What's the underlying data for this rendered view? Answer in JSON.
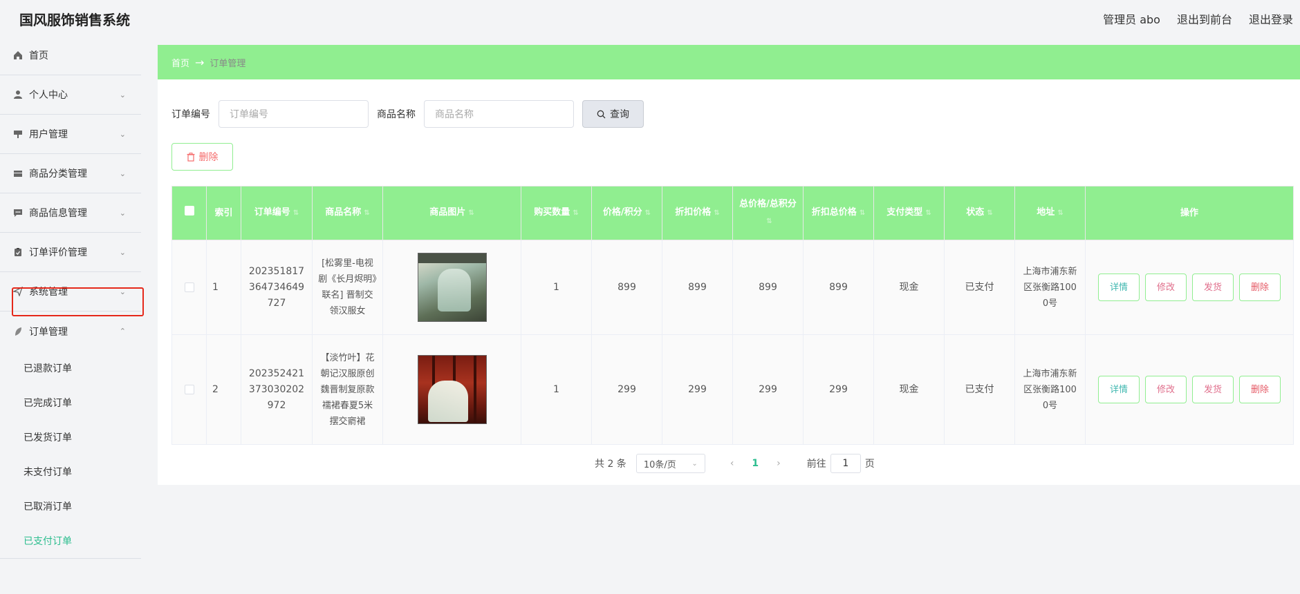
{
  "app": {
    "title": "国风服饰销售系统",
    "header_links": [
      "管理员 abo",
      "退出到前台",
      "退出登录"
    ]
  },
  "sidebar": {
    "items": [
      {
        "label": "首页",
        "icon": "home-icon",
        "has_children": false
      },
      {
        "label": "个人中心",
        "icon": "user-icon",
        "has_children": true
      },
      {
        "label": "用户管理",
        "icon": "brush-icon",
        "has_children": true
      },
      {
        "label": "商品分类管理",
        "icon": "box-icon",
        "has_children": true
      },
      {
        "label": "商品信息管理",
        "icon": "message-icon",
        "has_children": true
      },
      {
        "label": "订单评价管理",
        "icon": "clipboard-icon",
        "has_children": true
      },
      {
        "label": "系统管理",
        "icon": "send-icon",
        "has_children": true
      },
      {
        "label": "订单管理",
        "icon": "leaf-icon",
        "has_children": true,
        "expanded": true
      }
    ],
    "sub_items": [
      "已退款订单",
      "已完成订单",
      "已发货订单",
      "未支付订单",
      "已取消订单",
      "已支付订单"
    ],
    "active_sub": "已支付订单"
  },
  "breadcrumb": {
    "home": "首页",
    "separator": "→",
    "current": "订单管理"
  },
  "search": {
    "order_no_label": "订单编号",
    "order_no_placeholder": "订单编号",
    "product_name_label": "商品名称",
    "product_name_placeholder": "商品名称",
    "query_button": "查询"
  },
  "toolbar": {
    "delete_button": "删除"
  },
  "table": {
    "columns": [
      "索引",
      "订单编号",
      "商品名称",
      "商品图片",
      "购买数量",
      "价格/积分",
      "折扣价格",
      "总价格/总积分",
      "折扣总价格",
      "支付类型",
      "状态",
      "地址",
      "操作"
    ],
    "rows": [
      {
        "index": "1",
        "order_no": "202351817364734649727",
        "product_name": "[松雾里-电视剧《长月烬明》联名] 晋制交领汉服女",
        "quantity": "1",
        "price": "899",
        "discount_price": "899",
        "total_price": "899",
        "discount_total": "899",
        "payment_type": "现金",
        "status": "已支付",
        "address": "上海市浦东新区张衡路1000号"
      },
      {
        "index": "2",
        "order_no": "202352421373030202972",
        "product_name": "【淡竹叶】花朝记汉服原创 魏晋制复原款襦裙春夏5米摆交窬裙",
        "quantity": "1",
        "price": "299",
        "discount_price": "299",
        "total_price": "299",
        "discount_total": "299",
        "payment_type": "现金",
        "status": "已支付",
        "address": "上海市浦东新区张衡路1000号"
      }
    ],
    "actions": {
      "detail": "详情",
      "edit": "修改",
      "ship": "发货",
      "delete": "删除"
    }
  },
  "pagination": {
    "total_text": "共 2 条",
    "page_size": "10条/页",
    "current_page": "1",
    "goto_label": "前往",
    "goto_value": "1",
    "page_suffix": "页"
  },
  "colors": {
    "accent_green": "#90ee90",
    "active_text": "#2bbd8e",
    "highlight_border": "#e5281a"
  }
}
